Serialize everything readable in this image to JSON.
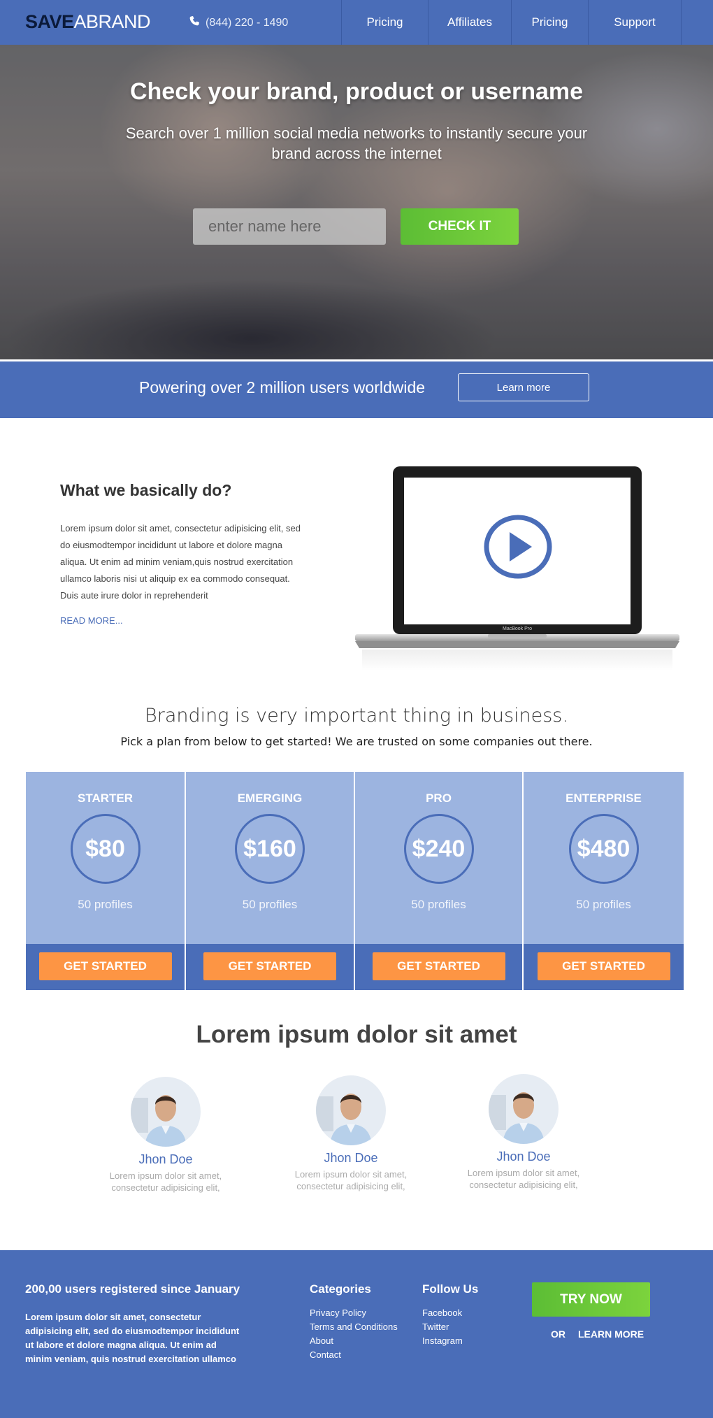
{
  "nav": {
    "logo_bold": "SAVE",
    "logo_light": "ABRAND",
    "phone": "(844) 220 - 1490",
    "items": [
      {
        "label": "Pricing"
      },
      {
        "label": "Affiliates"
      },
      {
        "label": "Pricing"
      },
      {
        "label": "Support"
      }
    ]
  },
  "hero": {
    "title": "Check your  brand, product or username",
    "subtitle": "Search over 1 million social media networks to instantly secure your brand across the internet",
    "input_placeholder": "enter name here",
    "button": "CHECK IT"
  },
  "band": {
    "text": "Powering over 2 million users worldwide",
    "button": "Learn more"
  },
  "about": {
    "heading": "What we basically do?",
    "body": "Lorem ipsum dolor sit amet, consectetur adipisicing elit, sed do eiusmodtempor incididunt ut labore et dolore magna aliqua. Ut enim ad minim veniam,quis nostrud exercitation ullamco laboris nisi ut aliquip ex ea commodo consequat. Duis aute irure dolor in reprehenderit",
    "read_more": "READ MORE...",
    "laptop_label": "MacBook Pro"
  },
  "branding": {
    "heading": "Branding is very important thing in business.",
    "subtitle": "Pick a plan from below to get started! We are trusted on some companies out there."
  },
  "plans": [
    {
      "name": "STARTER",
      "price": "$80",
      "profiles": "50 profiles",
      "button": "GET STARTED"
    },
    {
      "name": "EMERGING",
      "price": "$160",
      "profiles": "50 profiles",
      "button": "GET STARTED"
    },
    {
      "name": "PRO",
      "price": "$240",
      "profiles": "50 profiles",
      "button": "GET STARTED"
    },
    {
      "name": "ENTERPRISE",
      "price": "$480",
      "profiles": "50 profiles",
      "button": "GET STARTED"
    }
  ],
  "team": {
    "heading": "Lorem ipsum dolor sit amet",
    "members": [
      {
        "name": "Jhon Doe",
        "desc": "Lorem ipsum dolor sit amet, consectetur adipisicing elit,"
      },
      {
        "name": "Jhon Doe",
        "desc": "Lorem ipsum dolor sit amet, consectetur adipisicing elit,"
      },
      {
        "name": "Jhon Doe",
        "desc": "Lorem ipsum dolor sit amet, consectetur adipisicing elit,"
      }
    ]
  },
  "footer": {
    "heading": "200,00 users  registered since January",
    "body": "Lorem ipsum dolor sit amet, consectetur adipisicing elit, sed do eiusmodtempor incididunt ut labore et dolore magna aliqua. Ut enim ad minim veniam, quis nostrud exercitation ullamco",
    "categories_heading": "Categories",
    "categories": [
      "Privacy Policy",
      "Terms and Conditions",
      "About",
      "Contact"
    ],
    "follow_heading": "Follow Us",
    "follow": [
      "Facebook",
      "Twitter",
      "Instagram"
    ],
    "try_now": "TRY NOW",
    "or": "OR",
    "learn_more": "LEARN MORE"
  },
  "colors": {
    "brand_blue": "#4a6db8",
    "plan_light": "#9cb4e0",
    "green": "#6ac738",
    "orange": "#fd9544"
  }
}
